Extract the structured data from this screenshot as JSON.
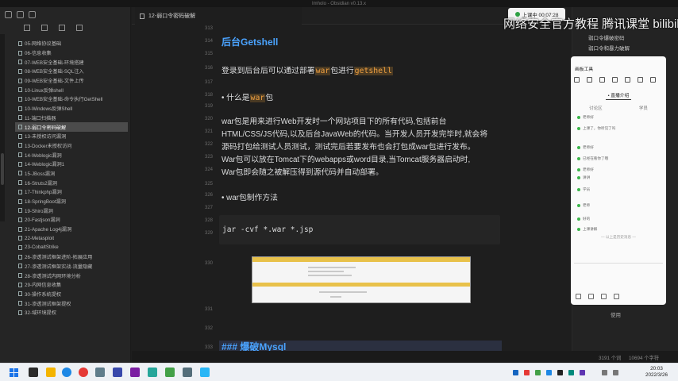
{
  "window": {
    "title": "Imholo - Obsidian v0.13.x"
  },
  "tab": {
    "title": "12-弱口令密码破解"
  },
  "live": {
    "label": "上课中 00:07:28"
  },
  "watermark": "网络安全官方教程 腾讯课堂 bilibili",
  "sidebar": {
    "items": [
      {
        "label": "05-网络协议基础"
      },
      {
        "label": "06-信息收集"
      },
      {
        "label": "07-WEB安全基础-环境搭建"
      },
      {
        "label": "08-WEB安全基础-SQL注入"
      },
      {
        "label": "09-WEB安全基础-文件上传"
      },
      {
        "label": "10-Linux反弹shell"
      },
      {
        "label": "10-WEB安全基础-命令执行GetShell"
      },
      {
        "label": "10-Windows反弹Shell"
      },
      {
        "label": "11-端口扫描器"
      },
      {
        "label": "12-弱口令密码破解"
      },
      {
        "label": "13-未授权访问漏洞"
      },
      {
        "label": "13-Docker未授权访问"
      },
      {
        "label": "14-Weblogic漏洞"
      },
      {
        "label": "14-Weblogic漏洞1"
      },
      {
        "label": "15-JBoss漏洞"
      },
      {
        "label": "16-Struts2漏洞"
      },
      {
        "label": "17-Thinkphp漏洞"
      },
      {
        "label": "18-SpringBoot漏洞"
      },
      {
        "label": "19-Shiro漏洞"
      },
      {
        "label": "20-Fastjson漏洞"
      },
      {
        "label": "21-Apache Log4j漏洞"
      },
      {
        "label": "22-Metasploit"
      },
      {
        "label": "23-CobaltStrike"
      },
      {
        "label": "26-渗透测试框架进阶-拓展应用"
      },
      {
        "label": "27-渗透测试框架实战-流量隐藏"
      },
      {
        "label": "28-渗透测试内网环境分析"
      },
      {
        "label": "29-内网信息收集"
      },
      {
        "label": "30-操作系统提权"
      },
      {
        "label": "31-渗透测试框架提权"
      },
      {
        "label": "32-域环境提权"
      }
    ],
    "active_index": 9
  },
  "editor": {
    "line_numbers": [
      "313",
      "314",
      "315",
      "316",
      "317",
      "318",
      "319",
      "320",
      "321",
      "322",
      "323",
      "324",
      "325",
      "326",
      "327",
      "328",
      "329",
      "330",
      "331",
      "332",
      "333"
    ],
    "heading1": "后台Getshell",
    "p1_a": "登录到后台后可以通过部署",
    "p1_kw1": "war",
    "p1_b": "包进行",
    "p1_kw2": "getshell",
    "bullet1_a": "• 什么是",
    "bullet1_kw": "war",
    "bullet1_b": "包",
    "para_l1": "war包是用来进行Web开发时一个网站项目下的所有代码,包括前台",
    "para_l2": "HTML/CSS/JS代码,以及后台JavaWeb的代码。当开发人员开发完毕时,就会将",
    "para_l3": "源码打包给测试人员测试，测试完后若要发布也会打包成war包进行发布。",
    "para_l4": "War包可以放在Tomcat下的webapps或word目录,当Tomcat服务器启动时,",
    "para_l5": "War包即会随之被解压得到源代码并自动部署。",
    "bullet2": "• war包制作方法",
    "code": "jar -cvf *.war *.jsp",
    "heading2": "### 爆破Mysql"
  },
  "outline": {
    "item1": "弱口令爆破密码",
    "item2": "弱口令和暴力破解"
  },
  "status": {
    "chars": "3191 个词",
    "words": "10694 个字符"
  },
  "right_bottom": "使用",
  "whiteboard": {
    "title": "画板工具",
    "tab": "• 直播介绍",
    "sub_left": "讨论区",
    "sub_right": "学员",
    "messages": [
      "老师好",
      "上课了，你听见了吗",
      "老师好",
      "已经在看你了哦",
      "老师好",
      "讲讲",
      "学员",
      "老师",
      "好的",
      "上课讲解"
    ],
    "footer_line": "— 以上是历史消息 —"
  },
  "taskbar": {
    "time": "20:03",
    "date": "2022/3/26"
  }
}
